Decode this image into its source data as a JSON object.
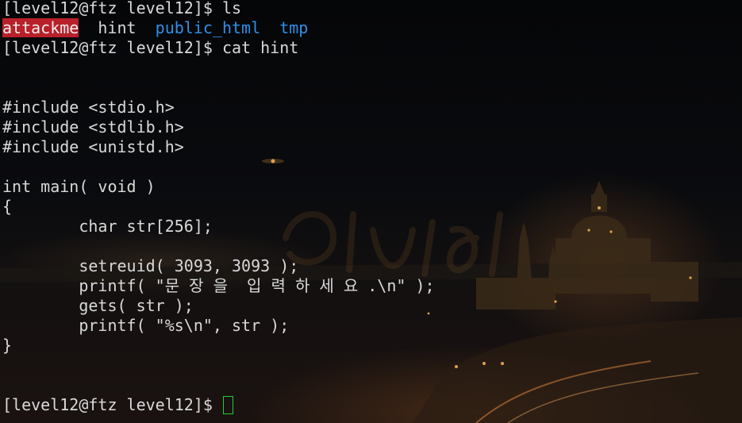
{
  "terminal": {
    "prompt": "[level12@ftz level12]$ ",
    "lines": [
      {
        "segments": [
          {
            "text": "[level12@ftz level12]$ ls",
            "style": "normal"
          }
        ]
      },
      {
        "segments": [
          {
            "text": "attackme",
            "style": "exec"
          },
          {
            "text": "  hint  ",
            "style": "normal"
          },
          {
            "text": "public_html",
            "style": "dir"
          },
          {
            "text": "  ",
            "style": "normal"
          },
          {
            "text": "tmp",
            "style": "dir"
          }
        ]
      },
      {
        "segments": [
          {
            "text": "[level12@ftz level12]$ cat hint",
            "style": "normal"
          }
        ]
      },
      {
        "segments": [
          {
            "text": "",
            "style": "normal"
          }
        ]
      },
      {
        "segments": [
          {
            "text": "",
            "style": "normal"
          }
        ]
      },
      {
        "segments": [
          {
            "text": "#include <stdio.h>",
            "style": "normal"
          }
        ]
      },
      {
        "segments": [
          {
            "text": "#include <stdlib.h>",
            "style": "normal"
          }
        ]
      },
      {
        "segments": [
          {
            "text": "#include <unistd.h>",
            "style": "normal"
          }
        ]
      },
      {
        "segments": [
          {
            "text": "",
            "style": "normal"
          }
        ]
      },
      {
        "segments": [
          {
            "text": "int main( void )",
            "style": "normal"
          }
        ]
      },
      {
        "segments": [
          {
            "text": "{",
            "style": "normal"
          }
        ]
      },
      {
        "segments": [
          {
            "text": "        char str[256];",
            "style": "normal"
          }
        ]
      },
      {
        "segments": [
          {
            "text": "",
            "style": "normal"
          }
        ]
      },
      {
        "segments": [
          {
            "text": "        setreuid( 3093, 3093 );",
            "style": "normal"
          }
        ]
      },
      {
        "segments": [
          {
            "text": "        printf( \"문 장 을  입 력 하 세 요 .\\n\" );",
            "style": "normal"
          }
        ]
      },
      {
        "segments": [
          {
            "text": "        gets( str );",
            "style": "normal"
          }
        ]
      },
      {
        "segments": [
          {
            "text": "        printf( \"%s\\n\", str );",
            "style": "normal"
          }
        ]
      },
      {
        "segments": [
          {
            "text": "}",
            "style": "normal"
          }
        ]
      },
      {
        "segments": [
          {
            "text": "",
            "style": "normal"
          }
        ]
      },
      {
        "segments": [
          {
            "text": "",
            "style": "normal"
          }
        ]
      },
      {
        "segments": [
          {
            "text": "[level12@ftz level12]$ ",
            "style": "normal"
          }
        ],
        "cursor": true
      }
    ]
  },
  "colors": {
    "foreground": "#d9d9d9",
    "exec_highlight": "#b8202a",
    "directory": "#2f8fe8",
    "cursor": "#29c93a",
    "background": "#000000"
  },
  "icons": {
    "cursor": "block-cursor-icon"
  }
}
